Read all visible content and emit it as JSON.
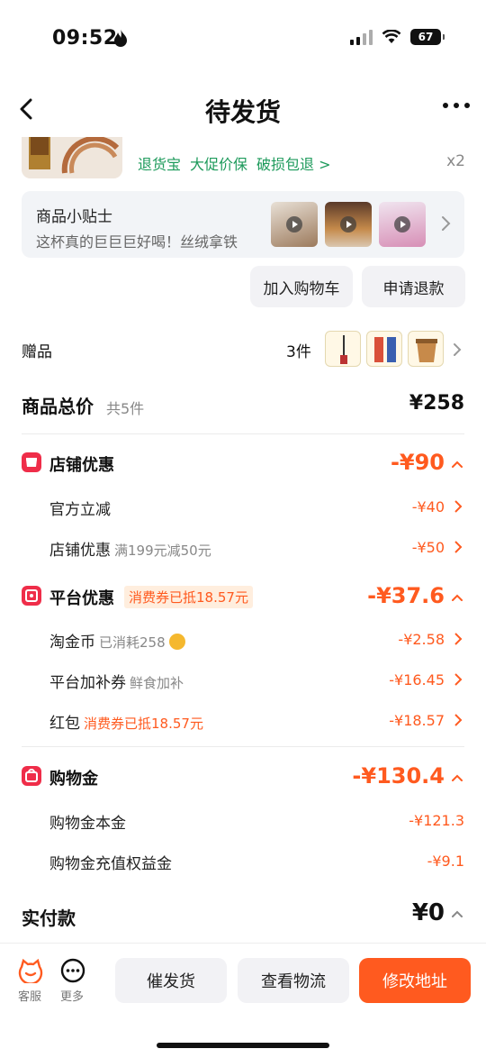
{
  "status_bar": {
    "time": "09:52",
    "battery": "67"
  },
  "nav": {
    "title": "待发货"
  },
  "product": {
    "services": [
      "退货宝",
      "大促价保",
      "破损包退 >"
    ],
    "quantity": "x2"
  },
  "tips": {
    "title": "商品小贴士",
    "subtitle": "这杯真的巨巨巨好喝！丝绒拿铁"
  },
  "actions": {
    "add_to_cart": "加入购物车",
    "refund": "申请退款"
  },
  "gift": {
    "label": "赠品",
    "count": "3件"
  },
  "total": {
    "label": "商品总价",
    "sub": "共5件",
    "value": "¥258"
  },
  "store_discount": {
    "title": "店铺优惠",
    "value": "-¥90",
    "rows": [
      {
        "label": "官方立减",
        "sub": "",
        "value": "-¥40"
      },
      {
        "label": "店铺优惠",
        "sub": "满199元减50元",
        "value": "-¥50"
      }
    ]
  },
  "platform_discount": {
    "title": "平台优惠",
    "tag": "消费券已抵18.57元",
    "value": "-¥37.6",
    "rows": [
      {
        "label": "淘金币",
        "sub": "已消耗258",
        "value": "-¥2.58"
      },
      {
        "label": "平台加补券",
        "sub": "鲜食加补",
        "value": "-¥16.45"
      },
      {
        "label": "红包",
        "sub": "消费券已抵18.57元",
        "value": "-¥18.57"
      }
    ]
  },
  "shopping_gold": {
    "title": "购物金",
    "value": "-¥130.4",
    "rows": [
      {
        "label": "购物金本金",
        "value": "-¥121.3"
      },
      {
        "label": "购物金充值权益金",
        "value": "-¥9.1"
      }
    ]
  },
  "paid": {
    "label": "实付款",
    "value": "¥0"
  },
  "bottom_bar": {
    "service_label": "客服",
    "more_label": "更多",
    "urge_label": "催发货",
    "logistics_label": "查看物流",
    "modify_address_label": "修改地址"
  },
  "colors": {
    "accent": "#ff5a1f",
    "brand_red": "#ef2d49",
    "service_green": "#1d9a5b"
  }
}
